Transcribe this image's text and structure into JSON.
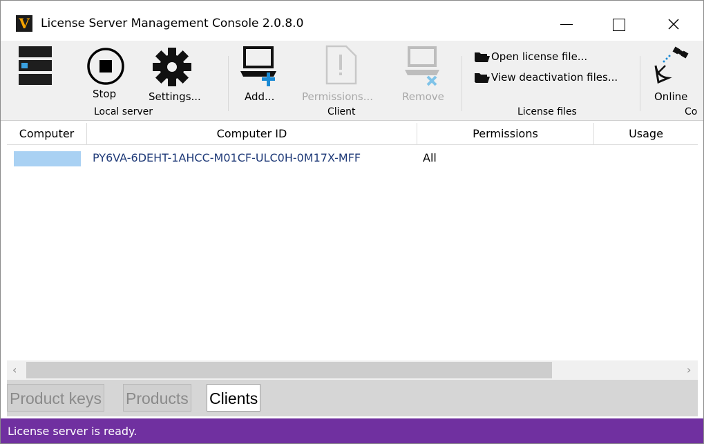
{
  "window": {
    "title": "License Server Management Console 2.0.8.0",
    "logo_letter": "V"
  },
  "ribbon": {
    "local_server": {
      "stop_label": "Stop",
      "settings_label": "Settings...",
      "group_label": "Local server"
    },
    "client": {
      "add_label": "Add...",
      "permissions_label": "Permissions...",
      "remove_label": "Remove",
      "group_label": "Client"
    },
    "license_files": {
      "open_label": "Open license file...",
      "view_deactivation_label": "View deactivation files...",
      "group_label": "License files"
    },
    "connection": {
      "online_label": "Online",
      "group_label_partial": "Co"
    }
  },
  "table": {
    "columns": [
      "Computer",
      "Computer ID",
      "Permissions",
      "Usage"
    ],
    "rows": [
      {
        "computer": "",
        "computer_id": "PY6VA-6DEHT-1AHCC-M01CF-ULC0H-0M17X-MFF",
        "permissions": "All",
        "usage": ""
      }
    ]
  },
  "scrollbar": {
    "left_arrow": "‹",
    "right_arrow": "›"
  },
  "tabs": [
    "Product keys",
    "Products",
    "Clients"
  ],
  "active_tab": "Clients",
  "status": {
    "text": "License server is ready."
  },
  "colors": {
    "status_bg": "#7030a0",
    "selection_swatch": "#a9d1f3",
    "id_text": "#1f3a78",
    "add_plus": "#1a8ad4",
    "remove_x": "#7fc3e8"
  }
}
